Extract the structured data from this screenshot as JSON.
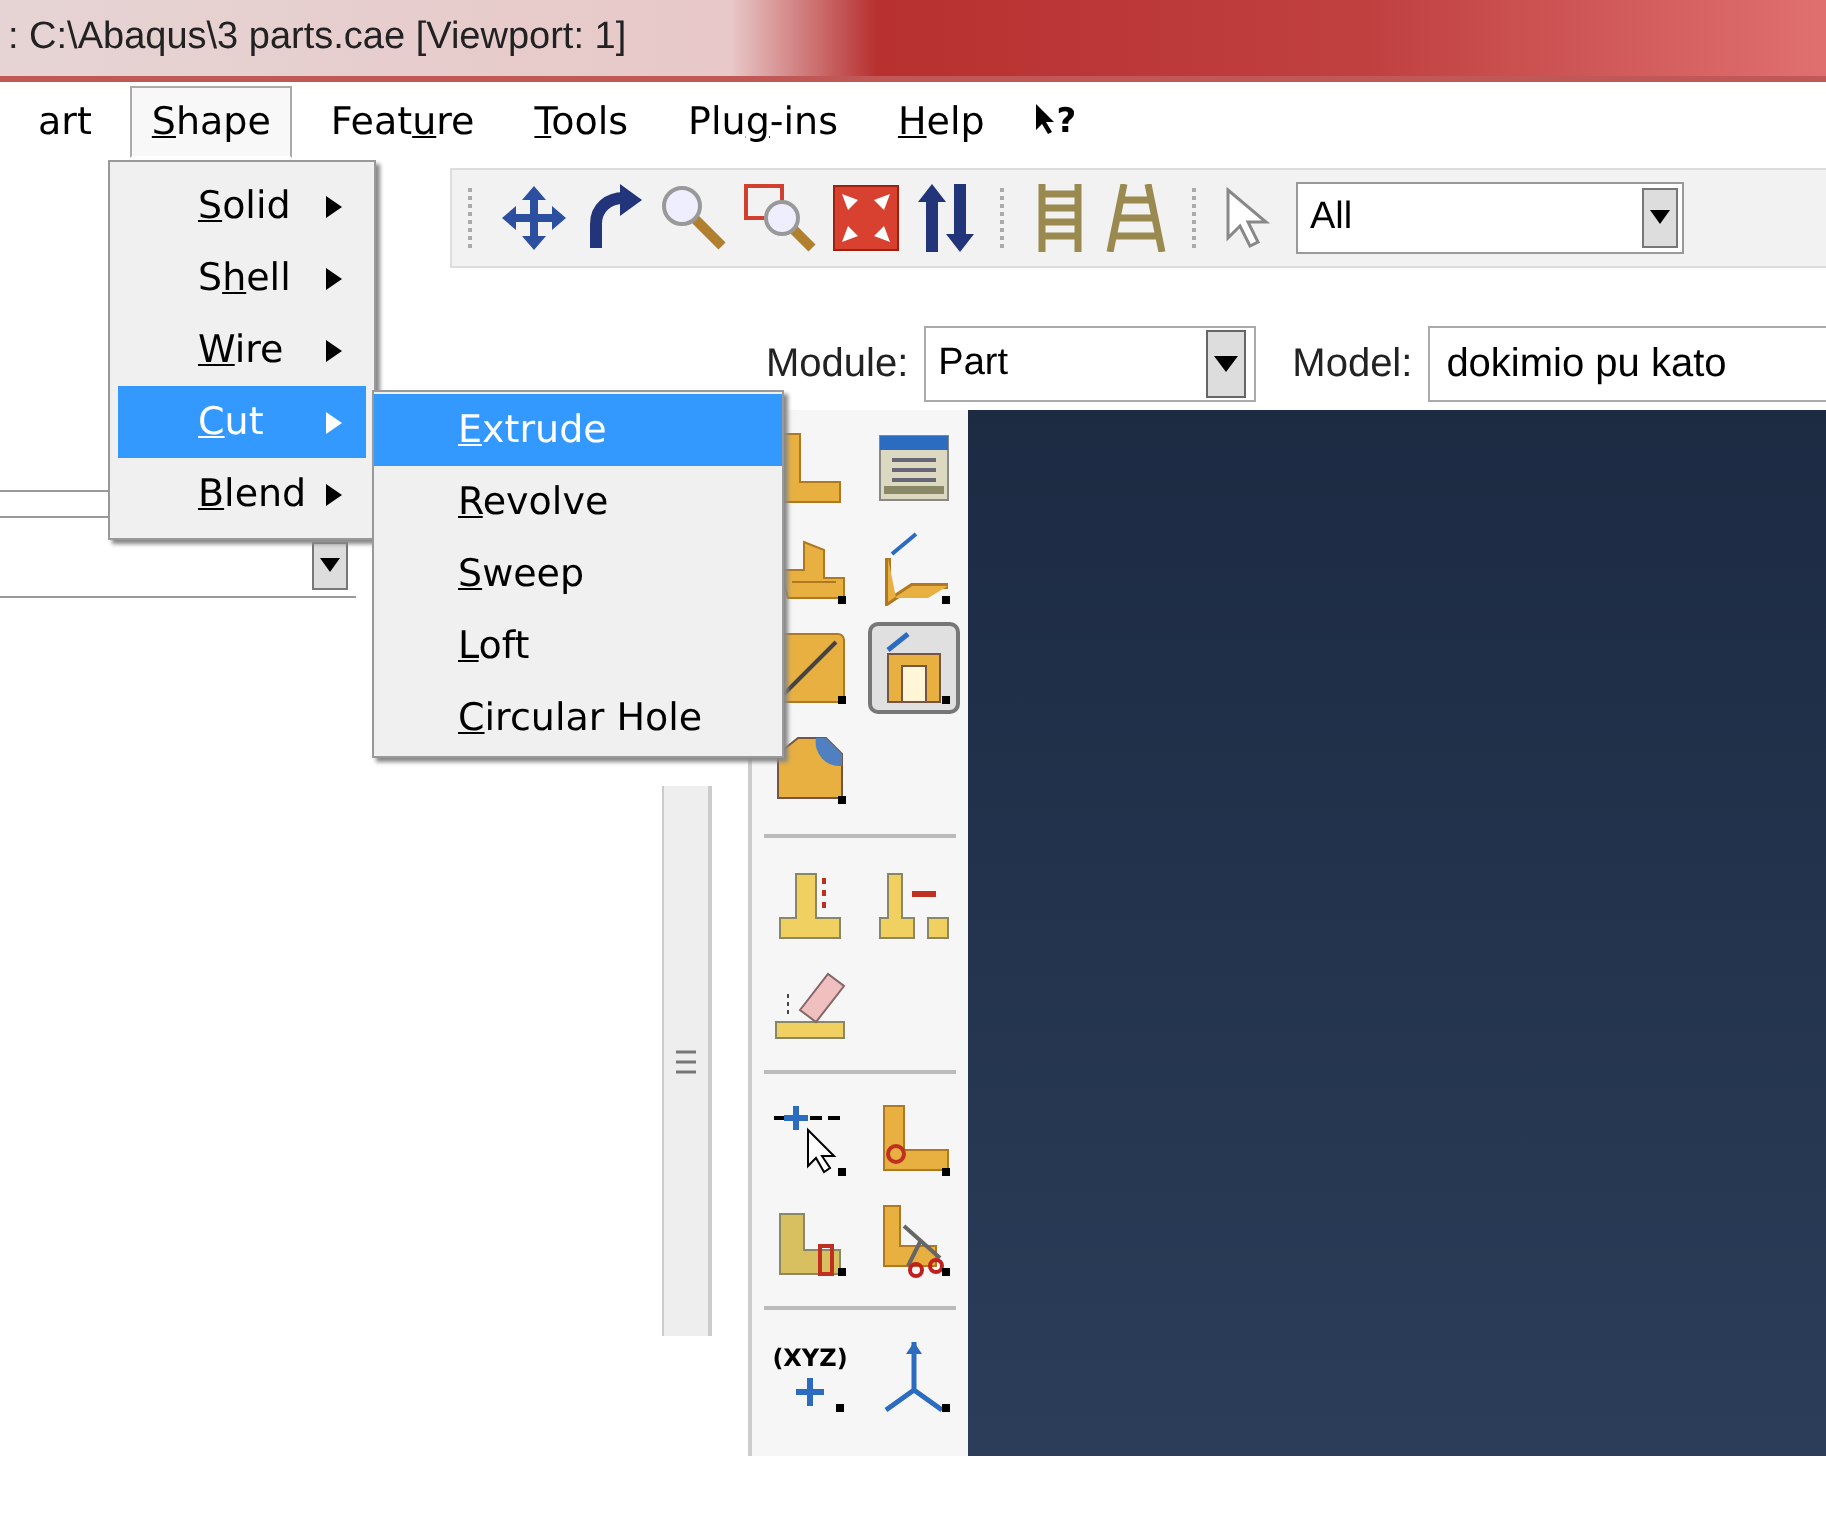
{
  "window": {
    "title": ": C:\\Abaqus\\3 parts.cae [Viewport: 1]"
  },
  "menu_bar": [
    {
      "label": {
        "pre": "art"
      },
      "selected": false
    },
    {
      "label": {
        "key": "S",
        "post": "hape"
      },
      "selected": true
    },
    {
      "label": {
        "pre": "Feat",
        "key": "u",
        "post": "re"
      },
      "selected": false
    },
    {
      "label": {
        "key": "T",
        "post": "ools"
      },
      "selected": false
    },
    {
      "label": {
        "pre": "Plu",
        "key": "g",
        "post": "-ins"
      },
      "selected": false
    },
    {
      "label": {
        "key": "H",
        "post": "elp"
      },
      "selected": false
    }
  ],
  "help_cursor": {
    "text": "?"
  },
  "shape_menu": [
    {
      "label": {
        "key": "S",
        "post": "olid"
      },
      "selected": false
    },
    {
      "label": {
        "pre": "S",
        "key": "h",
        "post": "ell"
      },
      "selected": false
    },
    {
      "label": {
        "key": "W",
        "post": "ire"
      },
      "selected": false
    },
    {
      "label": {
        "key": "C",
        "post": "ut"
      },
      "selected": true
    },
    {
      "label": {
        "key": "B",
        "post": "lend"
      },
      "selected": false
    }
  ],
  "cut_submenu": [
    {
      "label": {
        "key": "E",
        "post": "xtrude"
      },
      "selected": true
    },
    {
      "label": {
        "key": "R",
        "post": "evolve"
      },
      "selected": false
    },
    {
      "label": {
        "key": "S",
        "post": "weep"
      },
      "selected": false
    },
    {
      "label": {
        "key": "L",
        "post": "oft"
      },
      "selected": false
    },
    {
      "label": {
        "key": "C",
        "post": "ircular Hole"
      },
      "selected": false
    }
  ],
  "toolbar": [
    {
      "kind": "pan"
    },
    {
      "kind": "rotate"
    },
    {
      "kind": "zoom"
    },
    {
      "kind": "box-zoom"
    },
    {
      "kind": "fit"
    },
    {
      "kind": "flip"
    },
    {
      "kind": "sep"
    },
    {
      "kind": "ladder"
    },
    {
      "kind": "ladder2"
    },
    {
      "kind": "sep"
    },
    {
      "kind": "pointer"
    }
  ],
  "selection_filter": {
    "value": "All"
  },
  "context": {
    "module_label": "Module:",
    "module": "Part",
    "model_label": "Model:",
    "model": "dokimio pu kato"
  },
  "palette": [
    {
      "tools": [
        {
          "kind": "part",
          "selected": false
        },
        {
          "kind": "manager",
          "selected": false
        },
        {
          "kind": "stack",
          "selected": false
        },
        {
          "kind": "fold",
          "selected": false
        },
        {
          "kind": "line",
          "selected": false
        },
        {
          "kind": "extrude-cut",
          "selected": true
        },
        {
          "kind": "round",
          "selected": false
        }
      ]
    },
    {
      "tools": [
        {
          "kind": "tpart",
          "selected": false
        },
        {
          "kind": "tmove",
          "selected": false
        },
        {
          "kind": "eraser",
          "selected": false
        }
      ]
    },
    {
      "tools": [
        {
          "kind": "datum",
          "selected": false
        },
        {
          "kind": "corner",
          "selected": false
        },
        {
          "kind": "lpart",
          "selected": false
        },
        {
          "kind": "scissors",
          "selected": false
        }
      ]
    },
    {
      "tools": [
        {
          "kind": "xyz",
          "selected": false,
          "text": "(XYZ)"
        },
        {
          "kind": "axes",
          "selected": false
        }
      ]
    }
  ]
}
